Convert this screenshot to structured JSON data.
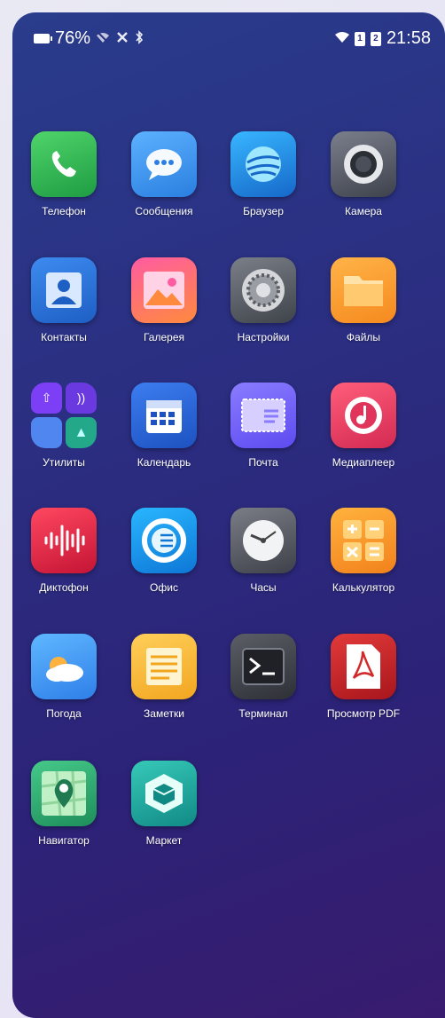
{
  "status_bar": {
    "battery_percent": "76%",
    "time": "21:58",
    "sim1": "1",
    "sim2": "2",
    "icons_left": [
      "battery-icon",
      "wifi-off-icon",
      "no-signal-icon",
      "bluetooth-icon"
    ],
    "icons_right": [
      "wifi-icon",
      "sim-1-icon",
      "sim-2-icon"
    ]
  },
  "apps": [
    {
      "label": "Телефон",
      "icon": "phone-icon"
    },
    {
      "label": "Сообщения",
      "icon": "messages-icon"
    },
    {
      "label": "Браузер",
      "icon": "browser-icon"
    },
    {
      "label": "Камера",
      "icon": "camera-icon"
    },
    {
      "label": "Контакты",
      "icon": "contacts-icon"
    },
    {
      "label": "Галерея",
      "icon": "gallery-icon"
    },
    {
      "label": "Настройки",
      "icon": "settings-icon"
    },
    {
      "label": "Файлы",
      "icon": "files-icon"
    },
    {
      "label": "Утилиты",
      "icon": "utilities-folder-icon"
    },
    {
      "label": "Календарь",
      "icon": "calendar-icon"
    },
    {
      "label": "Почта",
      "icon": "mail-icon"
    },
    {
      "label": "Медиаплеер",
      "icon": "media-player-icon"
    },
    {
      "label": "Диктофон",
      "icon": "voice-recorder-icon"
    },
    {
      "label": "Офис",
      "icon": "office-icon"
    },
    {
      "label": "Часы",
      "icon": "clock-icon"
    },
    {
      "label": "Калькулятор",
      "icon": "calculator-icon"
    },
    {
      "label": "Погода",
      "icon": "weather-icon"
    },
    {
      "label": "Заметки",
      "icon": "notes-icon"
    },
    {
      "label": "Терминал",
      "icon": "terminal-icon"
    },
    {
      "label": "Просмотр PDF",
      "icon": "pdf-viewer-icon"
    },
    {
      "label": "Навигатор",
      "icon": "navigator-icon"
    },
    {
      "label": "Маркет",
      "icon": "market-icon"
    }
  ],
  "colors": {
    "wallpaper_top": "#2a3c8c",
    "wallpaper_bottom": "#381b6e",
    "label_text": "#ffffff"
  }
}
